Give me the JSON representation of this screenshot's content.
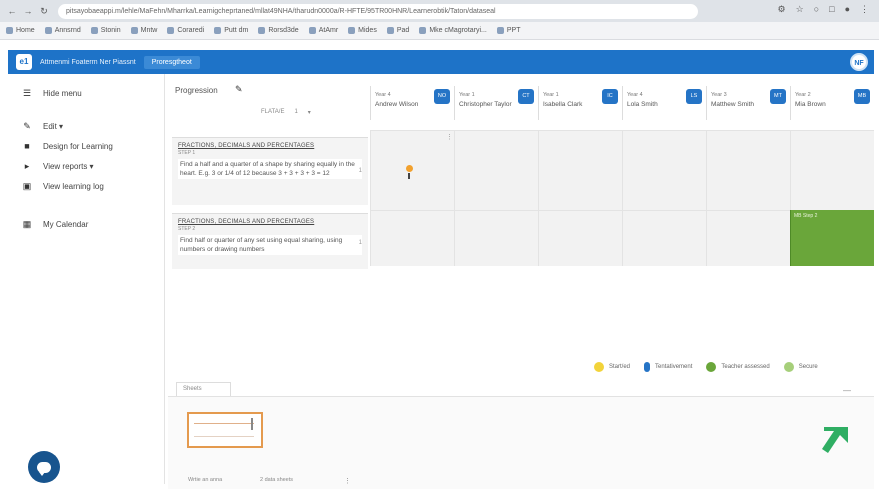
{
  "browser": {
    "url": "pitsayobaeappi.m/lehle/MaFehn/Mharrka/Learnigcheprtaned/mllat49NHA/tharudn0000a/R-HFTE/95TR00HNR/Learnerobtik/Taton/dataseal",
    "bookmarks": [
      "Home",
      "Annsrnd",
      "Stonin",
      "Mntw",
      "Coraredi",
      "Putt dm",
      "Rorsd3de",
      "AtAmr",
      "Mides",
      "Pad",
      "Mke cMagrotaryi...",
      "PPT"
    ]
  },
  "app": {
    "logo_text": "e1",
    "breadcrumb": "Attmenmi Foaterm Ner Piassnt",
    "active_crumb": "Proresgtheot",
    "avatar_initials": "NF"
  },
  "sidebar": {
    "items": [
      {
        "icon": "menu-icon",
        "label": "Hide menu"
      },
      {
        "icon": "edit-icon",
        "label": "Edit ▾"
      },
      {
        "icon": "document-icon",
        "label": "Design for Learning"
      },
      {
        "icon": "export-icon",
        "label": "View reports ▾"
      },
      {
        "icon": "log-icon",
        "label": "View learning log"
      },
      {
        "icon": "calendar-icon",
        "label": "My Calendar"
      }
    ]
  },
  "objectives": {
    "title": "Progression",
    "filter_label": "FLATA/E",
    "filter_num": "1",
    "cards": [
      {
        "heading": "FRACTIONS, DECIMALS AND PERCENTAGES",
        "sub": "STEP 1",
        "description": "Find a half and a quarter of a shape by sharing equally in the heart. E.g. 3 or 1/4 of 12 because 3 + 3 + 3 + 3 = 12",
        "num": "1"
      },
      {
        "heading": "FRACTIONS, DECIMALS AND PERCENTAGES",
        "sub": "STEP 2",
        "description": "Find half or quarter of any set using equal sharing, using numbers or drawing numbers",
        "num": "1"
      }
    ]
  },
  "pupils": [
    {
      "year": "Year 4",
      "name": "Andrew Wilson",
      "badge": "NO"
    },
    {
      "year": "Year 1",
      "name": "Christopher Taylor",
      "badge": "CT"
    },
    {
      "year": "Year 1",
      "name": "Isabella Clark",
      "badge": "IC"
    },
    {
      "year": "Year 4",
      "name": "Lola Smith",
      "badge": "LS"
    },
    {
      "year": "Year 3",
      "name": "Matthew Smith",
      "badge": "MT"
    },
    {
      "year": "Year 2",
      "name": "Mia Brown",
      "badge": "MB"
    }
  ],
  "green_cell_label": "MB Step 2",
  "legend": [
    {
      "label": "Start/ed",
      "color": "#f2d33a"
    },
    {
      "label": "Tentativement",
      "color": "#2574c6"
    },
    {
      "label": "Teacher assessed",
      "color": "#6aa63a"
    },
    {
      "label": "Secure",
      "color": "#a6cf7a"
    }
  ],
  "sheets": {
    "tab_label": "Sheets",
    "caption_left": "Wrtie an anna",
    "caption_right": "2 data sheets"
  },
  "colors": {
    "app_bar": "#1e73c8",
    "accent_orange": "#f2a12e",
    "assessed_green": "#6aa63a",
    "chat_button": "#17548e"
  }
}
